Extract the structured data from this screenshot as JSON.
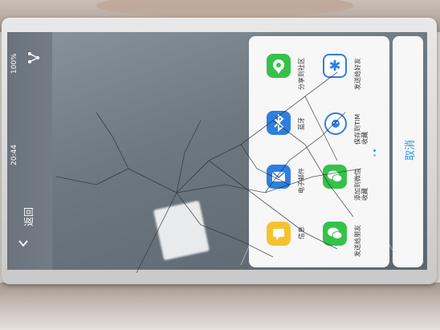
{
  "status_bar": {
    "battery": "100%",
    "time": "20:44"
  },
  "header": {
    "title": "返回"
  },
  "share_sheet": {
    "apps": [
      {
        "id": "community",
        "label": "分享到社区",
        "icon": "chat-bubble-pin-icon",
        "color": "#36c24a"
      },
      {
        "id": "friends",
        "label": "发送给好友",
        "icon": "asterisk-icon",
        "color": "#2f7fe0"
      },
      {
        "id": "bluetooth",
        "label": "蓝牙",
        "icon": "bluetooth-icon",
        "color": "#2f7fe0"
      },
      {
        "id": "tim",
        "label": "保存到TIM 收藏",
        "icon": "tim-icon",
        "color": "#2f7fe0"
      },
      {
        "id": "email",
        "label": "电子邮件",
        "icon": "mail-icon",
        "color": "#2f7fe0"
      },
      {
        "id": "wechat-fav",
        "label": "添加到微信 收藏",
        "icon": "wechat-icon",
        "color": "#36c24a"
      },
      {
        "id": "sms",
        "label": "信息",
        "icon": "message-icon",
        "color": "#f5c22f"
      },
      {
        "id": "wechat-friend",
        "label": "发送给朋友",
        "icon": "wechat-icon",
        "color": "#36c24a"
      }
    ],
    "page_count": 2,
    "current_page": 1,
    "cancel_label": "取消"
  }
}
